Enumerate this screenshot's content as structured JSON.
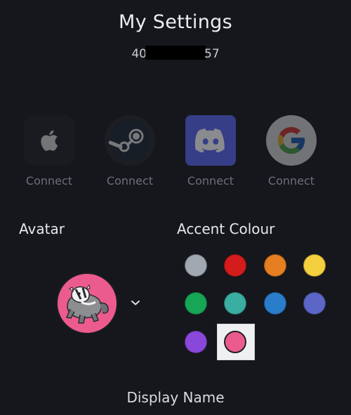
{
  "page": {
    "title": "My Settings",
    "user_id_start": "40",
    "user_id_end": "57"
  },
  "connections": [
    {
      "service": "Apple",
      "icon": "apple-icon",
      "label": "Connect"
    },
    {
      "service": "Steam",
      "icon": "steam-icon",
      "label": "Connect"
    },
    {
      "service": "Discord",
      "icon": "discord-icon",
      "label": "Connect"
    },
    {
      "service": "Google",
      "icon": "google-icon",
      "label": "Connect"
    }
  ],
  "avatar": {
    "title": "Avatar",
    "background": "#ec5b8d",
    "toggle_icon": "chevron-down-icon"
  },
  "accent": {
    "title": "Accent Colour",
    "selected": "pink",
    "colours": [
      {
        "name": "grey",
        "hex": "#a1a8b1"
      },
      {
        "name": "red",
        "hex": "#d41c1c"
      },
      {
        "name": "orange",
        "hex": "#e67e22"
      },
      {
        "name": "yellow",
        "hex": "#f4d03f"
      },
      {
        "name": "green",
        "hex": "#17a556"
      },
      {
        "name": "teal",
        "hex": "#3aaea0"
      },
      {
        "name": "blue",
        "hex": "#2a7dcb"
      },
      {
        "name": "indigo",
        "hex": "#5b66c6"
      },
      {
        "name": "purple",
        "hex": "#8a48db"
      },
      {
        "name": "pink",
        "hex": "#ec5b8d"
      }
    ]
  },
  "display_name": {
    "title": "Display Name"
  }
}
